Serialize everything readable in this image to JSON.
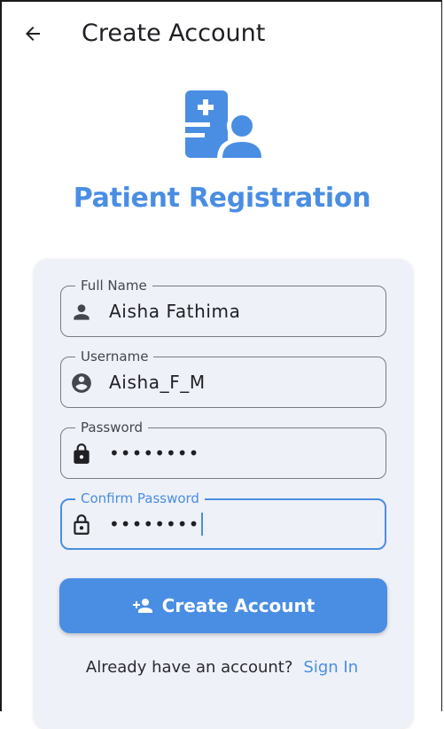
{
  "appbar": {
    "title": "Create Account",
    "back_icon": "arrow-left-icon"
  },
  "hero": {
    "icon": "patient-registration-icon",
    "title": "Patient Registration",
    "accent_color": "#4a8ee3"
  },
  "form": {
    "full_name": {
      "label": "Full Name",
      "value": "Aisha Fathima",
      "icon": "person-icon"
    },
    "username": {
      "label": "Username",
      "value": "Aisha_F_M",
      "icon": "account-circle-icon"
    },
    "password": {
      "label": "Password",
      "value": "••••••••",
      "icon": "lock-icon"
    },
    "confirm_password": {
      "label": "Confirm Password",
      "value": "••••••••",
      "icon": "lock-outline-icon",
      "focused": true
    }
  },
  "actions": {
    "create_label": "Create Account",
    "create_icon": "person-add-icon",
    "signin_prompt": "Already have an account?",
    "signin_link": "Sign In"
  }
}
